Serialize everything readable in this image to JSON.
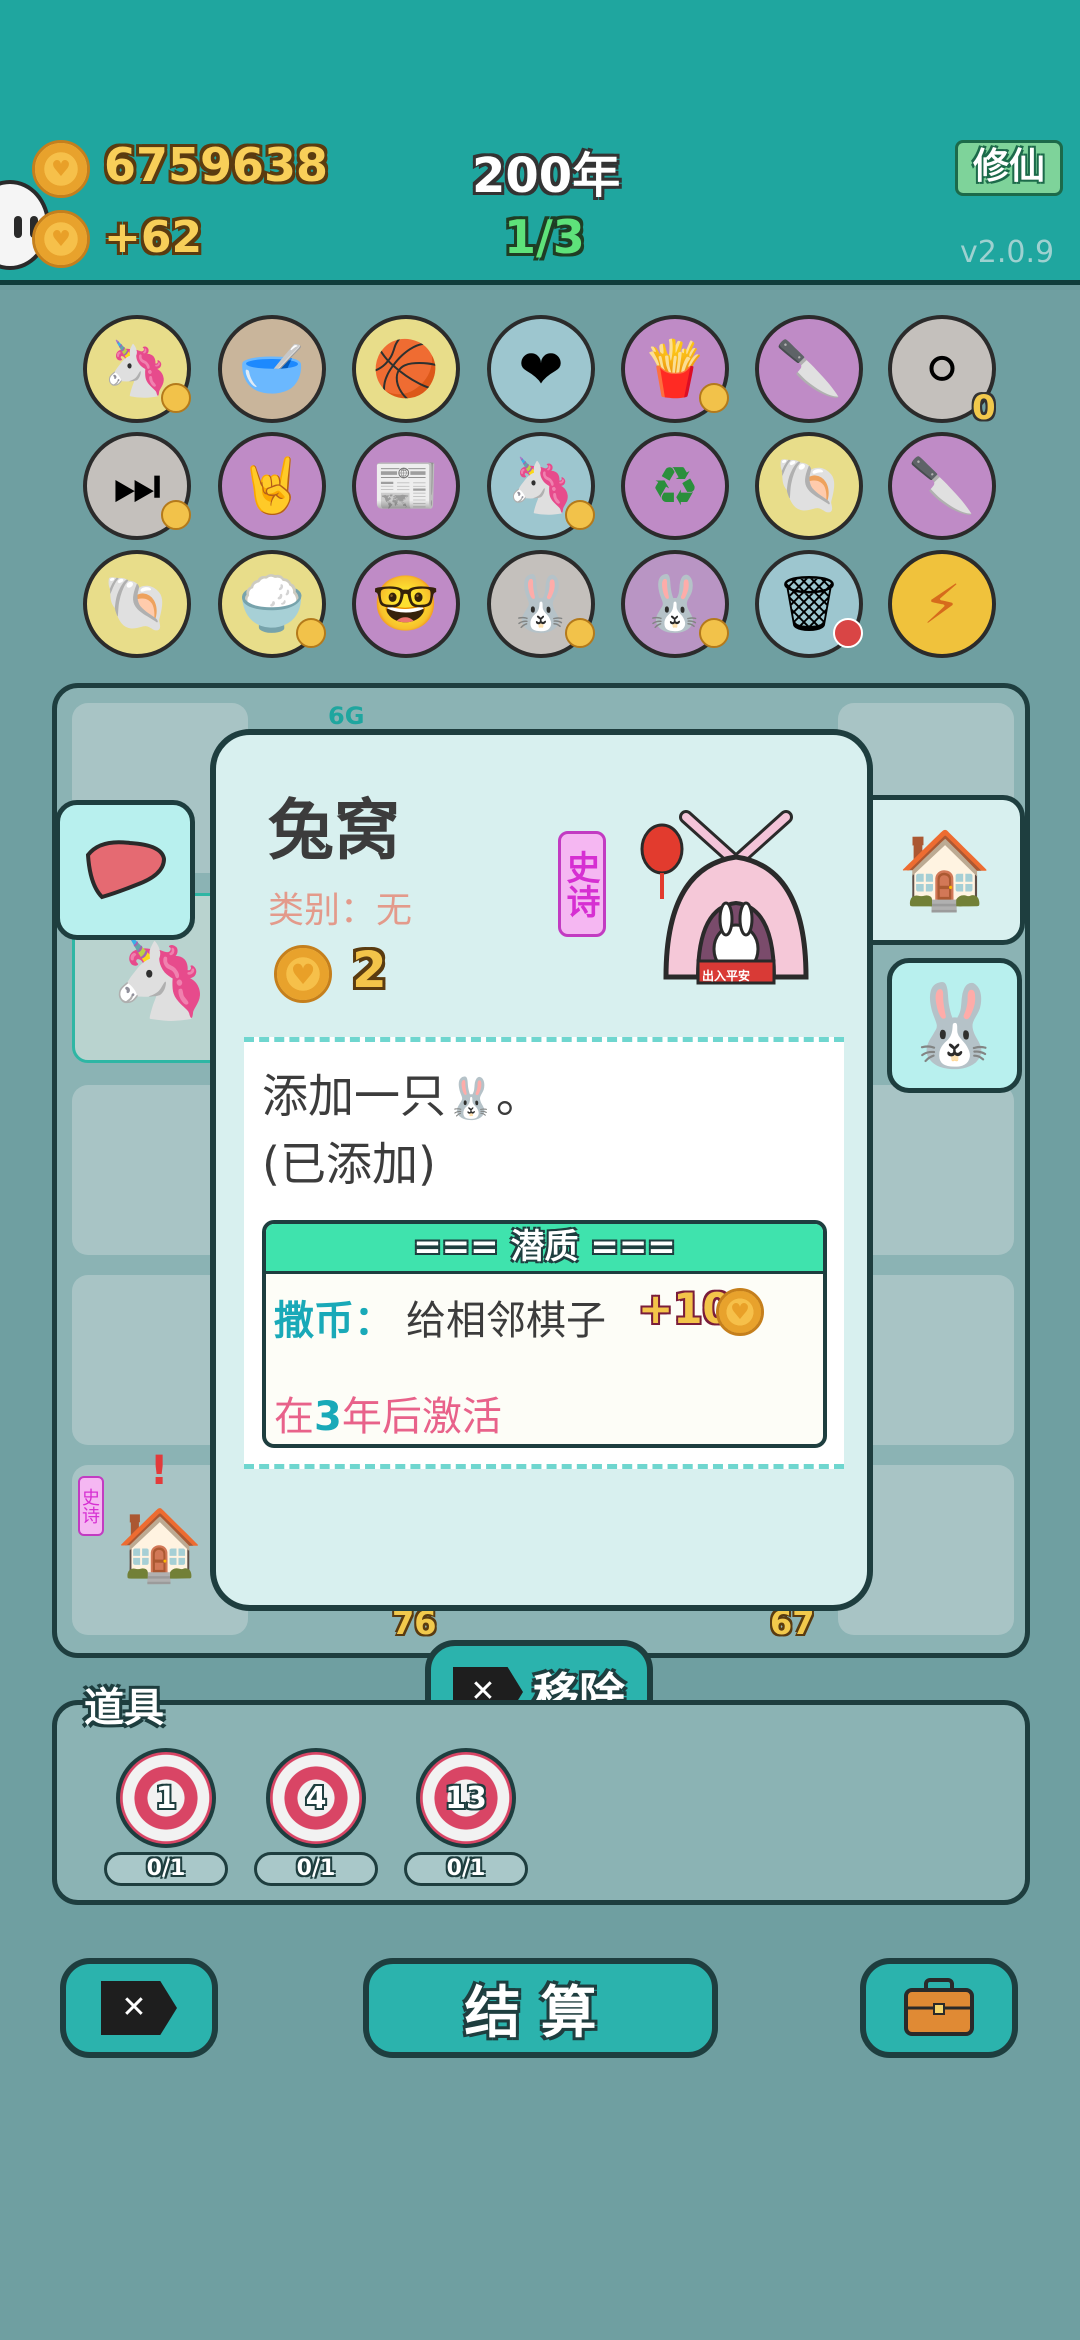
{
  "header": {
    "coins": "6759638",
    "income": "+62",
    "year": "200年",
    "progress": "1/3",
    "xiuxian_label": "修仙",
    "version": "v2.0.9"
  },
  "icon_rows": [
    [
      "unicorn-icon",
      "dog-bowl-icon",
      "basketballs-icon",
      "blood-bag-icon",
      "fries-icon",
      "cleaver-icon",
      "egg-tray-icon"
    ],
    [
      "skip-icon",
      "rock-hand-icon",
      "time-magazine-icon",
      "twin-unicorns-icon",
      "recycle-icon",
      "shell-icon",
      "cleaver-icon"
    ],
    [
      "shell-icon",
      "rice-bowl-icon",
      "math-geek-icon",
      "bunny-icon",
      "bunny-icon",
      "trash-bag-icon",
      "lightning-icon"
    ]
  ],
  "icon_zero_count": "0",
  "board_labels": {
    "top_tag": "6G",
    "bottom_left_num": "76",
    "bottom_right_num": "67",
    "epic_small": "史诗",
    "alert": "!"
  },
  "modal": {
    "title": "兔窝",
    "type_text": "类别：无",
    "cost": "2",
    "rarity": "史诗",
    "lantern_banner": "出入平安",
    "desc_line1": "添加一只",
    "desc_line1_end": "。",
    "desc_line2": "(已添加)",
    "trait_header": "=== 潜质 ===",
    "trait_name": "撒币：",
    "trait_desc": "给相邻棋子",
    "trait_plus": "+10",
    "trait_activate_prefix": "在",
    "trait_activate_num": "3",
    "trait_activate_suffix": "年后激活"
  },
  "remove_label": "移除",
  "props": {
    "title": "道具",
    "items": [
      {
        "num": "1",
        "count": "0/1"
      },
      {
        "num": "4",
        "count": "0/1"
      },
      {
        "num": "13",
        "count": "0/1"
      }
    ]
  },
  "bottom": {
    "settle_label": "结算"
  }
}
